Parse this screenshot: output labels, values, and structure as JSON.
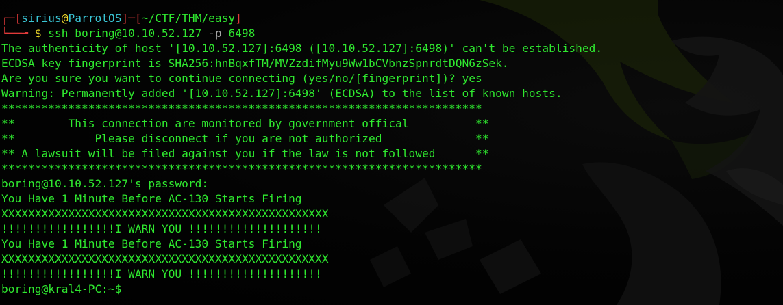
{
  "prompt": {
    "open_bracket": "┌─[",
    "user": "sirius",
    "at": "@",
    "host": "ParrotOS",
    "mid": "]─[",
    "path": "~/CTF/THM/easy",
    "close_bracket": "]",
    "arrow": "└──╼",
    "dollar": " $ ",
    "command": "ssh boring@10.10.52.127 ",
    "flag": "-p",
    "port": " 6498"
  },
  "output_lines": [
    "The authenticity of host '[10.10.52.127]:6498 ([10.10.52.127]:6498)' can't be established.",
    "ECDSA key fingerprint is SHA256:hnBqxfTM/MVZzdifMyu9Ww1bCVbnzSpnrdtDQN6zSek.",
    "Are you sure you want to continue connecting (yes/no/[fingerprint])? yes",
    "Warning: Permanently added '[10.10.52.127]:6498' (ECDSA) to the list of known hosts.",
    "************************************************************************",
    "**        This connection are monitored by government offical          **",
    "**            Please disconnect if you are not authorized              **",
    "** A lawsuit will be filed against you if the law is not followed      **",
    "************************************************************************",
    "boring@10.10.52.127's password:",
    "You Have 1 Minute Before AC-130 Starts Firing",
    "XXXXXXXXXXXXXXXXXXXXXXXXXXXXXXXXXXXXXXXXXXXXXXXXX",
    "!!!!!!!!!!!!!!!!!I WARN YOU !!!!!!!!!!!!!!!!!!!!",
    "You Have 1 Minute Before AC-130 Starts Firing",
    "XXXXXXXXXXXXXXXXXXXXXXXXXXXXXXXXXXXXXXXXXXXXXXXXX",
    "!!!!!!!!!!!!!!!!!I WARN YOU !!!!!!!!!!!!!!!!!!!!"
  ],
  "final_prompt": "boring@kral4-PC:~$",
  "colors": {
    "terminal_bg": "#000000",
    "text_green": "#2fe82f",
    "prompt_red": "#e03a3a",
    "prompt_cyan": "#3ac6d6",
    "prompt_yellow": "#e8d22a",
    "prompt_white": "#e6e6e6"
  }
}
